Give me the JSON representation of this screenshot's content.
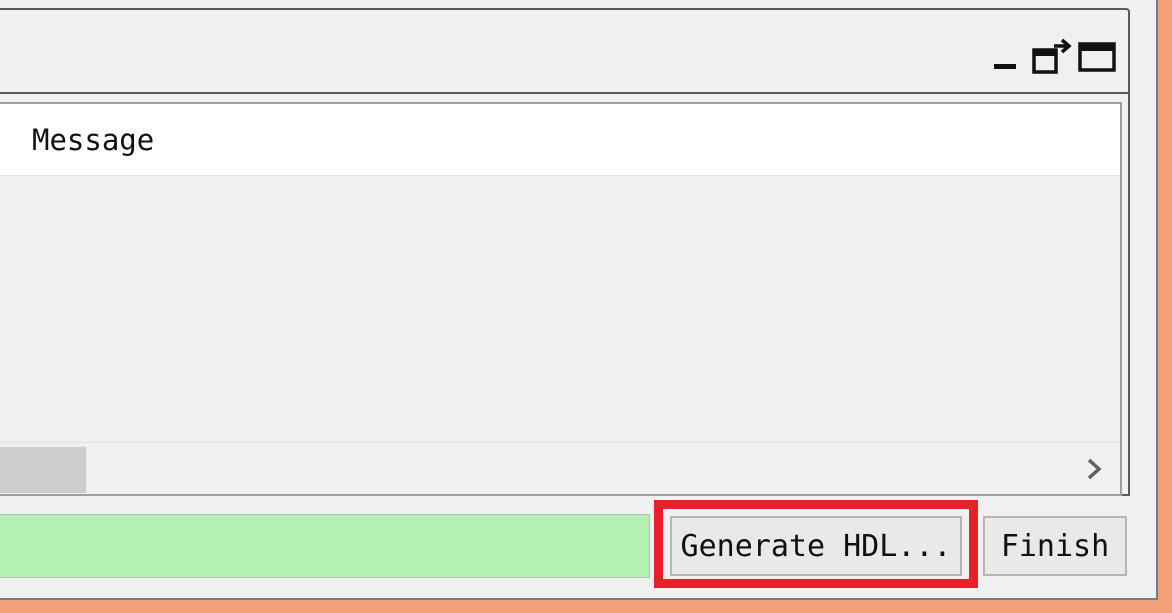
{
  "panel": {
    "controls": [
      {
        "name": "minimize-icon"
      },
      {
        "name": "undock-icon"
      },
      {
        "name": "maximize-icon"
      }
    ]
  },
  "table": {
    "columns": [
      "Message"
    ],
    "rows": []
  },
  "progress": {
    "fill_fraction": 1.0,
    "color": "#b4f0b4"
  },
  "buttons": {
    "generate_hdl": "Generate HDL...",
    "finish": "Finish"
  },
  "colors": {
    "highlight": "#e8202a",
    "background": "#f2a07a"
  }
}
